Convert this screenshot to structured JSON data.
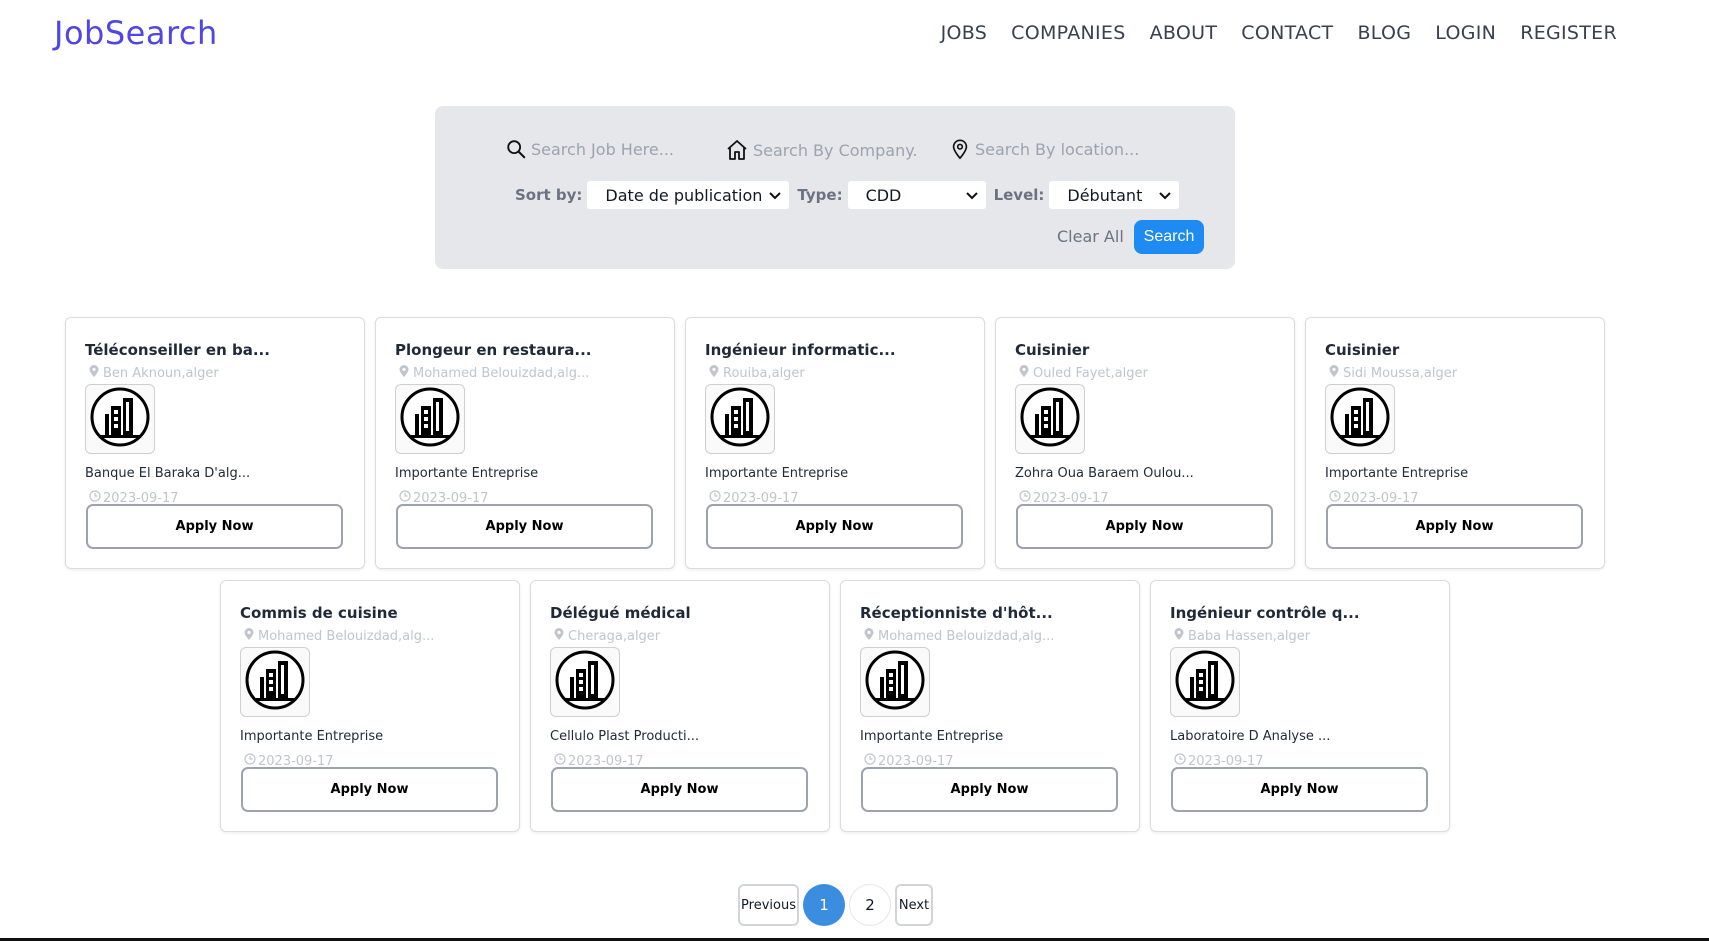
{
  "header": {
    "brand": "JobSearch",
    "nav": [
      "JOBS",
      "COMPANIES",
      "ABOUT",
      "CONTACT",
      "BLOG",
      "LOGIN",
      "REGISTER"
    ]
  },
  "search": {
    "job_placeholder": "Search Job Here...",
    "company_placeholder": "Search By Company...",
    "location_placeholder": "Search By location...",
    "sort_label": "Sort by:",
    "sort_value": "Date de publication",
    "type_label": "Type:",
    "type_value": "CDD",
    "level_label": "Level:",
    "level_value": "Débutant",
    "clear_label": "Clear All",
    "search_label": "Search"
  },
  "jobs": [
    {
      "title": "Téléconseiller en ba...",
      "location": "Ben Aknoun,alger",
      "company": "Banque El Baraka D'alg...",
      "date": "2023-09-17",
      "apply": "Apply Now"
    },
    {
      "title": "Plongeur en restaura...",
      "location": "Mohamed Belouizdad,alg...",
      "company": "Importante Entreprise",
      "date": "2023-09-17",
      "apply": "Apply Now"
    },
    {
      "title": "Ingénieur informatic...",
      "location": "Rouiba,alger",
      "company": "Importante Entreprise",
      "date": "2023-09-17",
      "apply": "Apply Now"
    },
    {
      "title": "Cuisinier",
      "location": "Ouled Fayet,alger",
      "company": "Zohra Oua Baraem Oulou...",
      "date": "2023-09-17",
      "apply": "Apply Now"
    },
    {
      "title": "Cuisinier",
      "location": "Sidi Moussa,alger",
      "company": "Importante Entreprise",
      "date": "2023-09-17",
      "apply": "Apply Now"
    },
    {
      "title": "Commis de cuisine",
      "location": "Mohamed Belouizdad,alg...",
      "company": "Importante Entreprise",
      "date": "2023-09-17",
      "apply": "Apply Now"
    },
    {
      "title": "Délégué médical",
      "location": "Cheraga,alger",
      "company": "Cellulo Plast Producti...",
      "date": "2023-09-17",
      "apply": "Apply Now"
    },
    {
      "title": "Réceptionniste d'hôt...",
      "location": "Mohamed Belouizdad,alg...",
      "company": "Importante Entreprise",
      "date": "2023-09-17",
      "apply": "Apply Now"
    },
    {
      "title": "Ingénieur contrôle q...",
      "location": "Baba Hassen,alger",
      "company": "Laboratoire D Analyse ...",
      "date": "2023-09-17",
      "apply": "Apply Now"
    }
  ],
  "pagination": {
    "previous": "Previous",
    "pages": [
      "1",
      "2"
    ],
    "current": "1",
    "next": "Next"
  }
}
